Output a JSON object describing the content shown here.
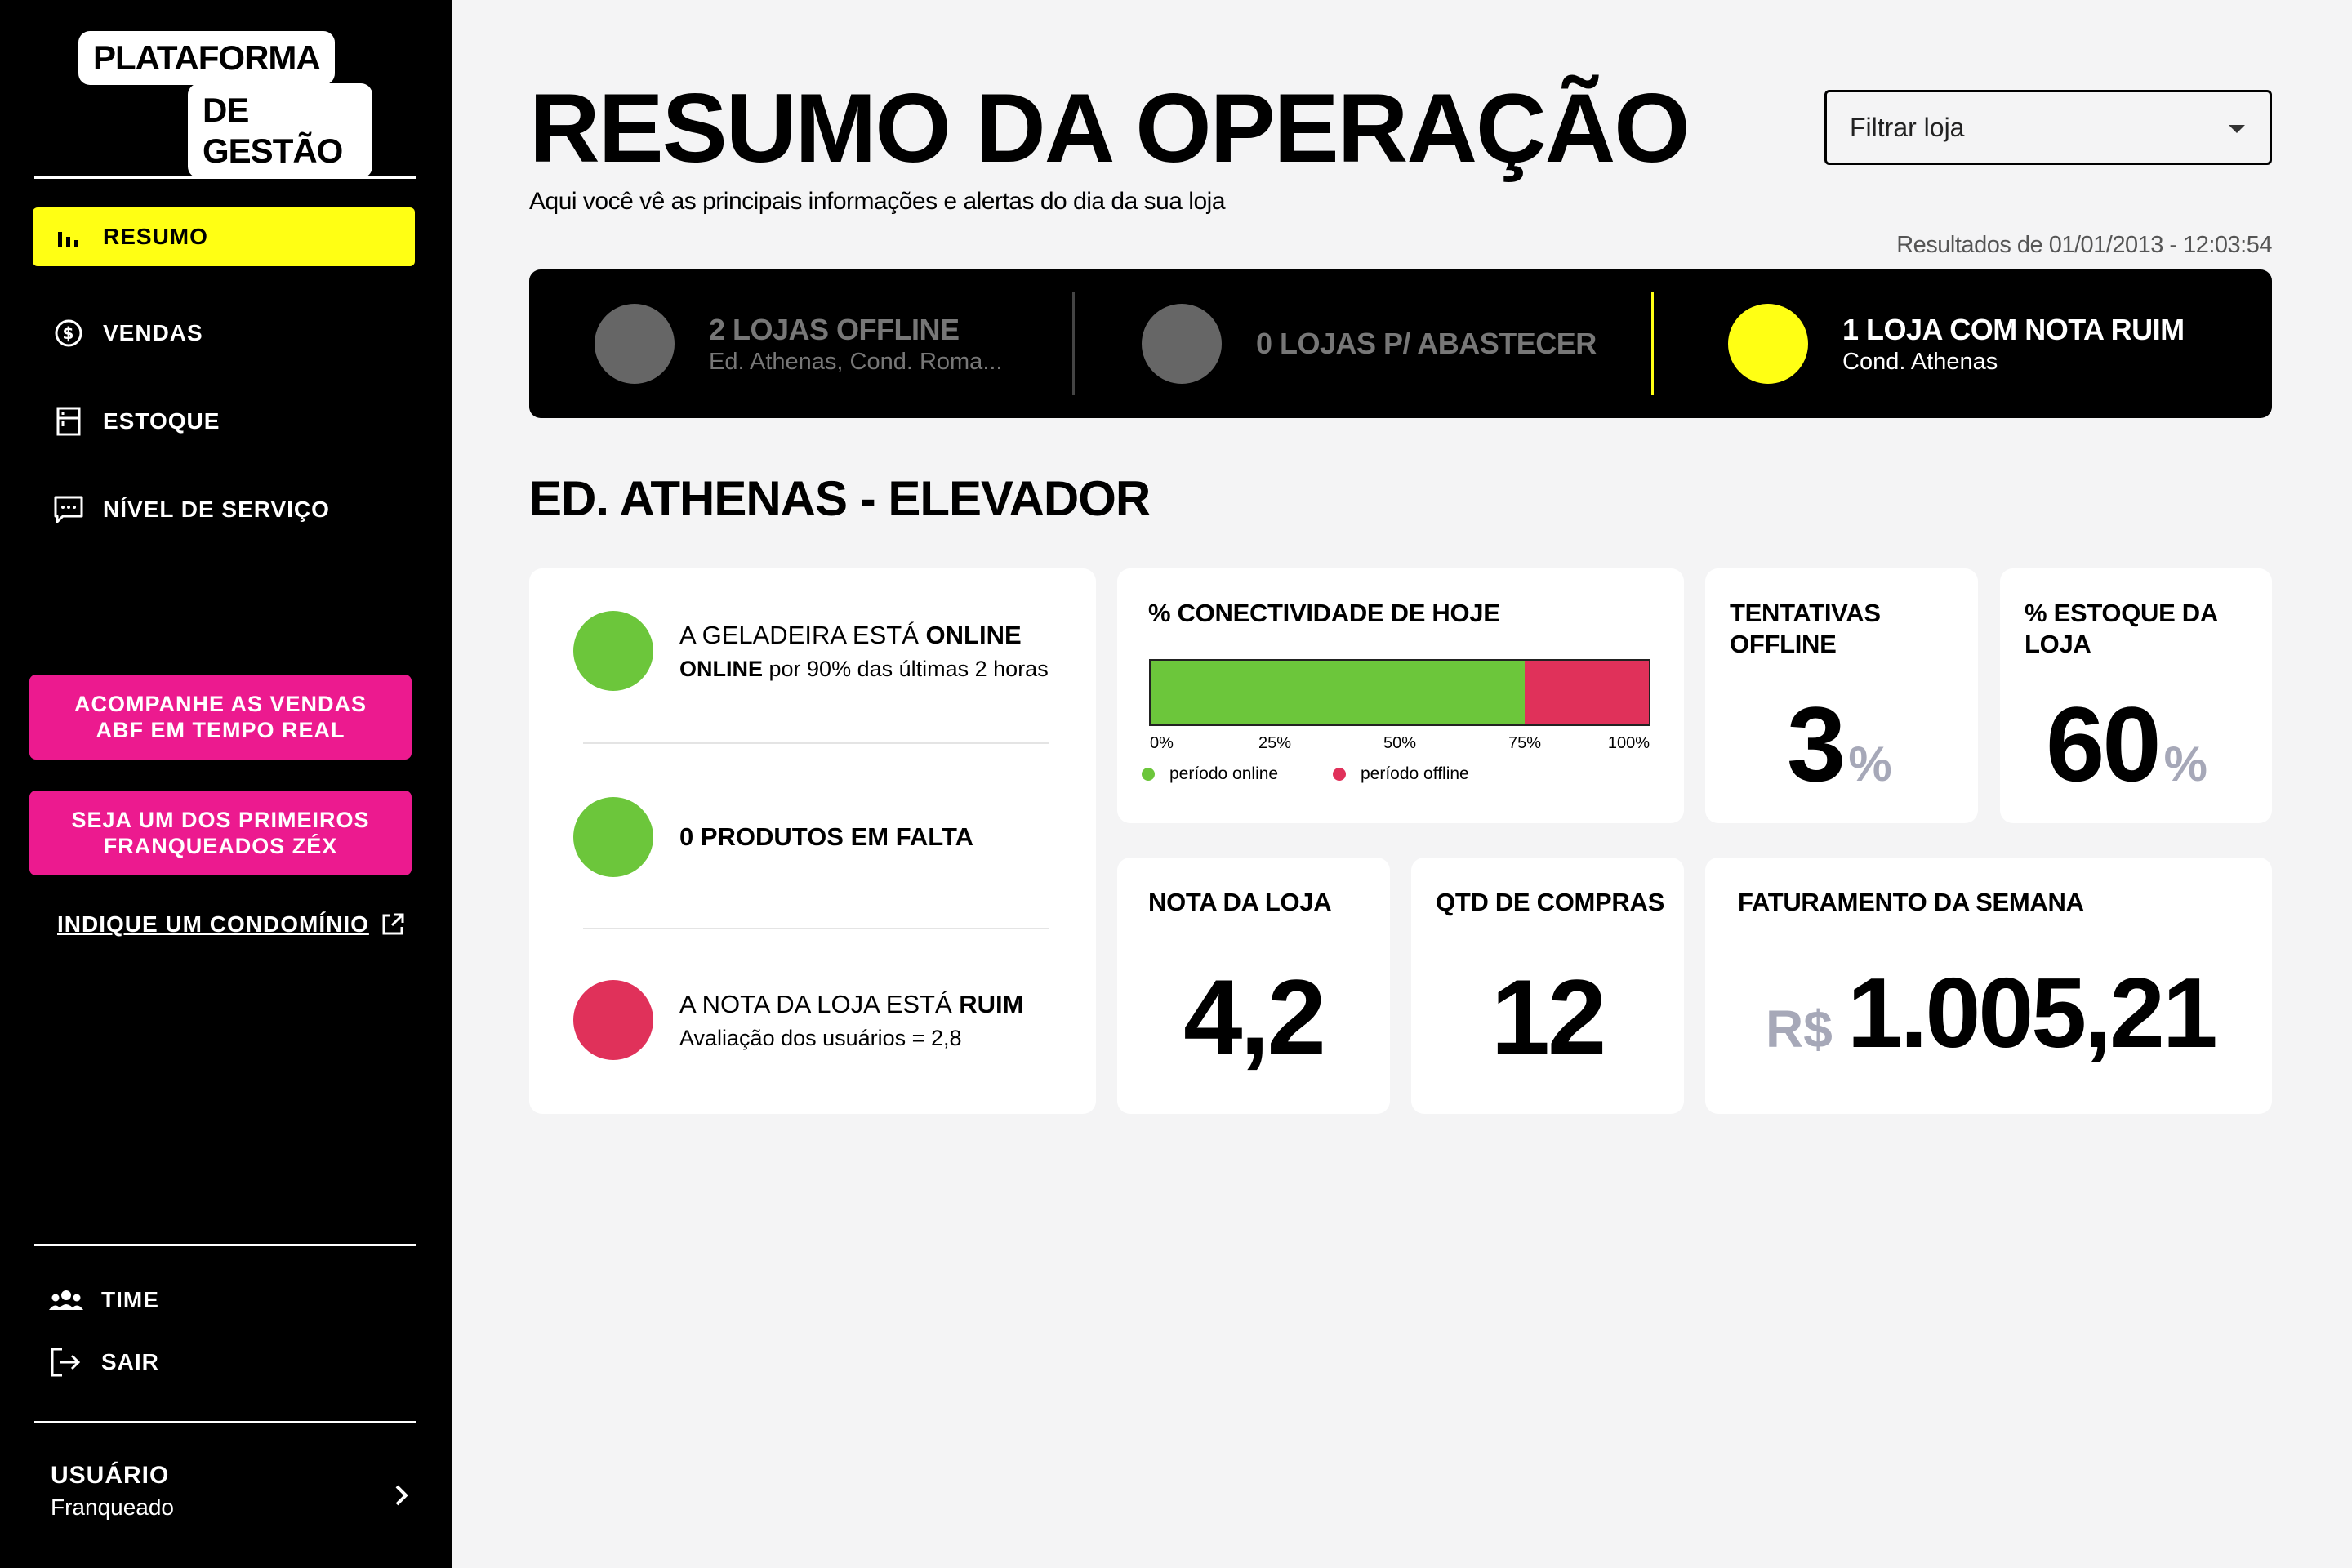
{
  "brand": {
    "line1": "PLATAFORMA",
    "line2": "DE GESTÃO"
  },
  "nav": [
    {
      "label": "RESUMO",
      "icon": "bar-chart-icon"
    },
    {
      "label": "VENDAS",
      "icon": "dollar-circle-icon"
    },
    {
      "label": "ESTOQUE",
      "icon": "fridge-icon"
    },
    {
      "label": "NÍVEL DE SERVIÇO",
      "icon": "chat-icon"
    }
  ],
  "cta": {
    "abf": "ACOMPANHE AS VENDAS ABF EM TEMPO REAL",
    "franchise": "SEJA UM DOS PRIMEIROS FRANQUEADOS ZÉX",
    "indicate": "INDIQUE UM CONDOMÍNIO"
  },
  "bottom_nav": {
    "team": "TIME",
    "logout": "SAIR"
  },
  "user": {
    "name": "USUÁRIO",
    "role": "Franqueado"
  },
  "header": {
    "title": "RESUMO DA OPERAÇÃO",
    "subtitle": "Aqui você vê as principais informações e alertas do dia da sua loja",
    "filter_placeholder": "Filtrar loja",
    "results": "Resultados de 01/01/2013 - 12:03:54"
  },
  "alerts": [
    {
      "title": "2 LOJAS OFFLINE",
      "sub": "Ed. Athenas, Cond. Roma...",
      "color": "#666666"
    },
    {
      "title": "0 LOJAS P/ ABASTECER",
      "sub": "",
      "color": "#666666"
    },
    {
      "title": "1 LOJA COM NOTA RUIM",
      "sub": "Cond. Athenas",
      "color": "#ffff14"
    }
  ],
  "store": {
    "name": "ED. ATHENAS - ELEVADOR",
    "status": [
      {
        "prefix": "A GELADEIRA ESTÁ ",
        "strong": "ONLINE",
        "sub_strong": "ONLINE",
        "sub": " por 90% das últimas 2 horas",
        "color": "#6cc63b"
      },
      {
        "strong": "0 PRODUTOS EM FALTA",
        "color": "#6cc63b"
      },
      {
        "prefix": "A NOTA DA LOJA ESTÁ ",
        "strong": "RUIM",
        "sub": "Avaliação dos usuários = 2,8",
        "color": "#e0315a"
      }
    ],
    "connectivity": {
      "label": "% CONECTIVIDADE DE HOJE",
      "ticks": [
        "0%",
        "25%",
        "50%",
        "75%",
        "100%"
      ],
      "legend_online": "período online",
      "legend_offline": "período offline"
    },
    "offline_attempts": {
      "label": "TENTATIVAS OFFLINE",
      "value": "3",
      "unit": "%"
    },
    "stock": {
      "label": "% ESTOQUE DA LOJA",
      "value": "60",
      "unit": "%"
    },
    "rating": {
      "label": "NOTA DA LOJA",
      "value": "4,2"
    },
    "purchases": {
      "label": "QTD DE COMPRAS",
      "value": "12"
    },
    "revenue": {
      "label": "FATURAMENTO DA SEMANA",
      "currency": "R$",
      "value": "1.005,21"
    }
  },
  "colors": {
    "accent": "#ffff14",
    "pink": "#ec1a8f",
    "green": "#6cc63b",
    "red": "#e0315a",
    "gray": "#666666"
  },
  "chart_data": {
    "type": "bar",
    "orientation": "horizontal-stacked",
    "categories": [
      "% CONECTIVIDADE DE HOJE"
    ],
    "series": [
      {
        "name": "período online",
        "values": [
          75
        ]
      },
      {
        "name": "período offline",
        "values": [
          25
        ]
      }
    ],
    "xlim": [
      0,
      100
    ]
  }
}
